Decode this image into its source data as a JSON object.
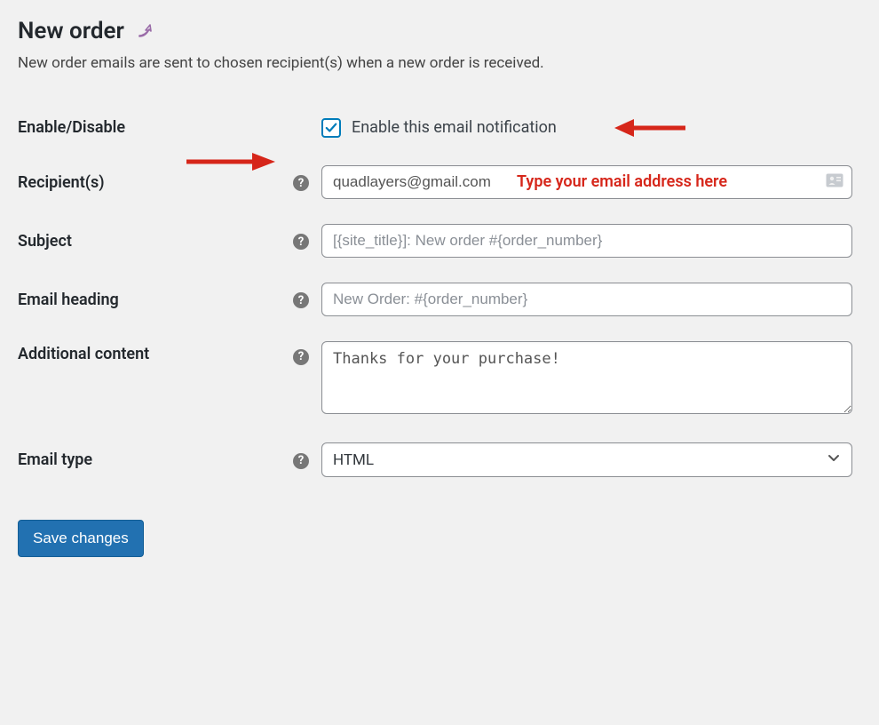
{
  "page": {
    "title": "New order",
    "description": "New order emails are sent to chosen recipient(s) when a new order is received."
  },
  "fields": {
    "enable": {
      "label": "Enable/Disable",
      "checkbox_label": "Enable this email notification",
      "checked": true
    },
    "recipients": {
      "label": "Recipient(s)",
      "value": "quadlayers@gmail.com",
      "placeholder": ""
    },
    "subject": {
      "label": "Subject",
      "value": "",
      "placeholder": "[{site_title}]: New order #{order_number}"
    },
    "heading": {
      "label": "Email heading",
      "value": "",
      "placeholder": "New Order: #{order_number}"
    },
    "additional": {
      "label": "Additional content",
      "value": "Thanks for your purchase!"
    },
    "email_type": {
      "label": "Email type",
      "value": "HTML"
    }
  },
  "buttons": {
    "save": "Save changes"
  },
  "annotations": {
    "recipients_hint": "Type your email address here"
  },
  "colors": {
    "accent": "#2271b1",
    "arrow": "#d6261a"
  }
}
